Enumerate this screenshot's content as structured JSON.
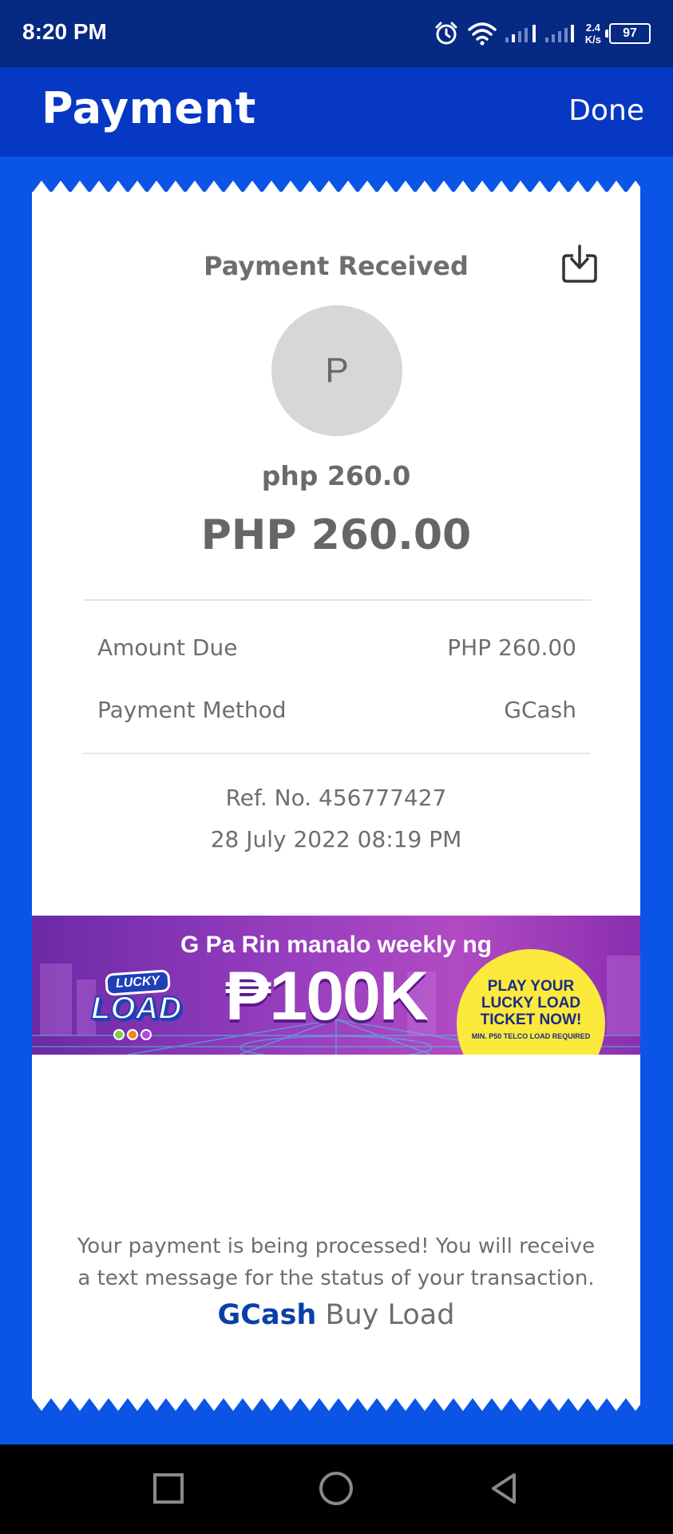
{
  "status_bar": {
    "time": "8:20 PM",
    "net_speed_value": "2.4",
    "net_speed_unit": "K/s",
    "battery": "97",
    "icons": [
      "alarm-icon",
      "wifi-icon",
      "signal-icon",
      "battery-icon"
    ]
  },
  "header": {
    "title": "Payment",
    "done_label": "Done"
  },
  "receipt": {
    "title": "Payment Received",
    "avatar_initial": "P",
    "merchant_amount": "php 260.0",
    "total_amount": "PHP 260.00",
    "details": [
      {
        "label": "Amount Due",
        "value": "PHP 260.00"
      },
      {
        "label": "Payment Method",
        "value": "GCash"
      }
    ],
    "reference": "Ref. No. 456777427",
    "datetime": "28 July 2022 08:19 PM",
    "message": "Your payment is being processed! You will receive a text message for the status of your transaction.",
    "brand_name": "GCash",
    "brand_service": "Buy Load"
  },
  "banner": {
    "headline": "G Pa Rin manalo weekly ng",
    "prize": "₱100K",
    "logo_top": "LUCKY",
    "logo_bottom": "LOAD",
    "cta": "PLAY YOUR LUCKY LOAD TICKET NOW!",
    "cta_note": "MIN. P50 TELCO LOAD REQUIRED"
  },
  "colors": {
    "status_bar_bg": "#062983",
    "header_bg": "#0638c3",
    "page_bg": "#0a55e6",
    "brand_blue": "#0a3fa8",
    "banner_yellow": "#fbe93b"
  }
}
